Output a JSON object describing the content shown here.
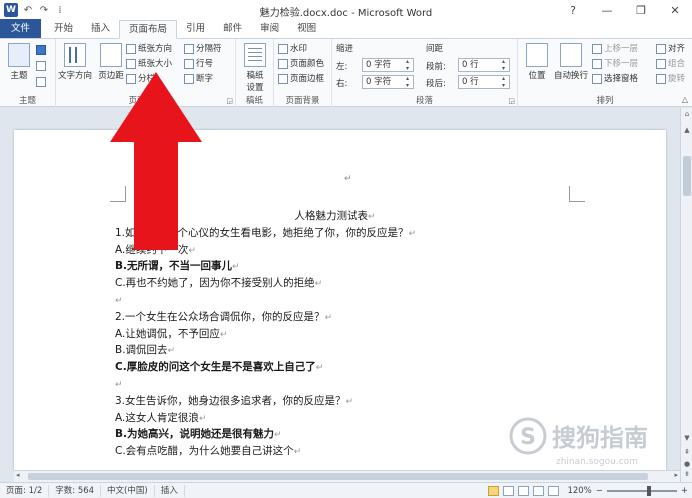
{
  "titlebar": {
    "app_letter": "W",
    "title": "魅力检验.docx.doc - Microsoft Word",
    "undo_symbol": "↶",
    "redo_symbol": "↷",
    "qat_menu_symbol": "⁞",
    "window_controls": {
      "help": "?",
      "minimize": "—",
      "restore": "❐",
      "close": "✕"
    }
  },
  "tabs": [
    {
      "label": "文件"
    },
    {
      "label": "开始"
    },
    {
      "label": "插入"
    },
    {
      "label": "页面布局"
    },
    {
      "label": "引用"
    },
    {
      "label": "邮件"
    },
    {
      "label": "审阅"
    },
    {
      "label": "视图"
    }
  ],
  "ribbon": {
    "groups": {
      "theme": {
        "label": "主题",
        "button": "主题"
      },
      "page_setup": {
        "label": "页面设置",
        "text_direction": "文字方向",
        "margins": "页边距",
        "orientation": "纸张方向",
        "size": "纸张大小",
        "columns": "分栏",
        "breaks": "分隔符",
        "line_numbers": "行号",
        "hyphenation": "断字"
      },
      "draft": {
        "label": "稿纸",
        "button_line1": "稿纸",
        "button_line2": "设置"
      },
      "page_background": {
        "label": "页面背景",
        "watermark": "水印",
        "page_color": "页面颜色",
        "page_borders": "页面边框"
      },
      "paragraph": {
        "label": "段落",
        "indent_title": "缩进",
        "spacing_title": "间距",
        "left_label": "左:",
        "left_value": "0 字符",
        "right_label": "右:",
        "right_value": "0 字符",
        "before_label": "段前:",
        "before_value": "0 行",
        "after_label": "段后:",
        "after_value": "0 行"
      },
      "arrange": {
        "label": "排列",
        "position": "位置",
        "wrap_text": "自动换行",
        "bring_forward": "上移一层",
        "send_backward": "下移一层",
        "selection_pane": "选择窗格",
        "align": "对齐",
        "group": "组合",
        "rotate": "旋转"
      }
    }
  },
  "document": {
    "lines": [
      {
        "text": "人格魅力测试表",
        "bold": false,
        "center": true
      },
      {
        "text": "1.如果你约一个心仪的女生看电影，她拒绝了你，你的反应是？",
        "bold": false
      },
      {
        "text": "A.继续约下一次",
        "bold": false
      },
      {
        "text": "B.无所谓，不当一回事儿",
        "bold": true
      },
      {
        "text": "C.再也不约她了，因为你不接受别人的拒绝",
        "bold": false
      },
      {
        "text": "",
        "bold": false
      },
      {
        "text": "2.一个女生在公众场合调侃你，你的反应是？",
        "bold": false
      },
      {
        "text": "A.让她调侃，不予回应",
        "bold": false
      },
      {
        "text": "B.调侃回去",
        "bold": false
      },
      {
        "text": "C.厚脸皮的问这个女生是不是喜欢上自己了",
        "bold": true
      },
      {
        "text": "",
        "bold": false
      },
      {
        "text": "3.女生告诉你，她身边很多追求者，你的反应是？",
        "bold": false
      },
      {
        "text": "A.这女人肯定很浪",
        "bold": false
      },
      {
        "text": "B.为她高兴，说明她还是很有魅力",
        "bold": true
      },
      {
        "text": "C.会有点吃醋，为什么她要自己讲这个",
        "bold": false
      }
    ],
    "paragraph_mark": "↵"
  },
  "statusbar": {
    "page": "页面: 1/2",
    "words": "字数: 564",
    "language": "中文(中国)",
    "mode": "插入",
    "zoom": "120%",
    "zoom_minus": "−",
    "zoom_plus": "+"
  },
  "watermark": {
    "brand": "搜狗指南",
    "url": "zhinan.sogou.com"
  },
  "colors": {
    "accent": "#2b579a",
    "arrow": "#e8141c"
  }
}
